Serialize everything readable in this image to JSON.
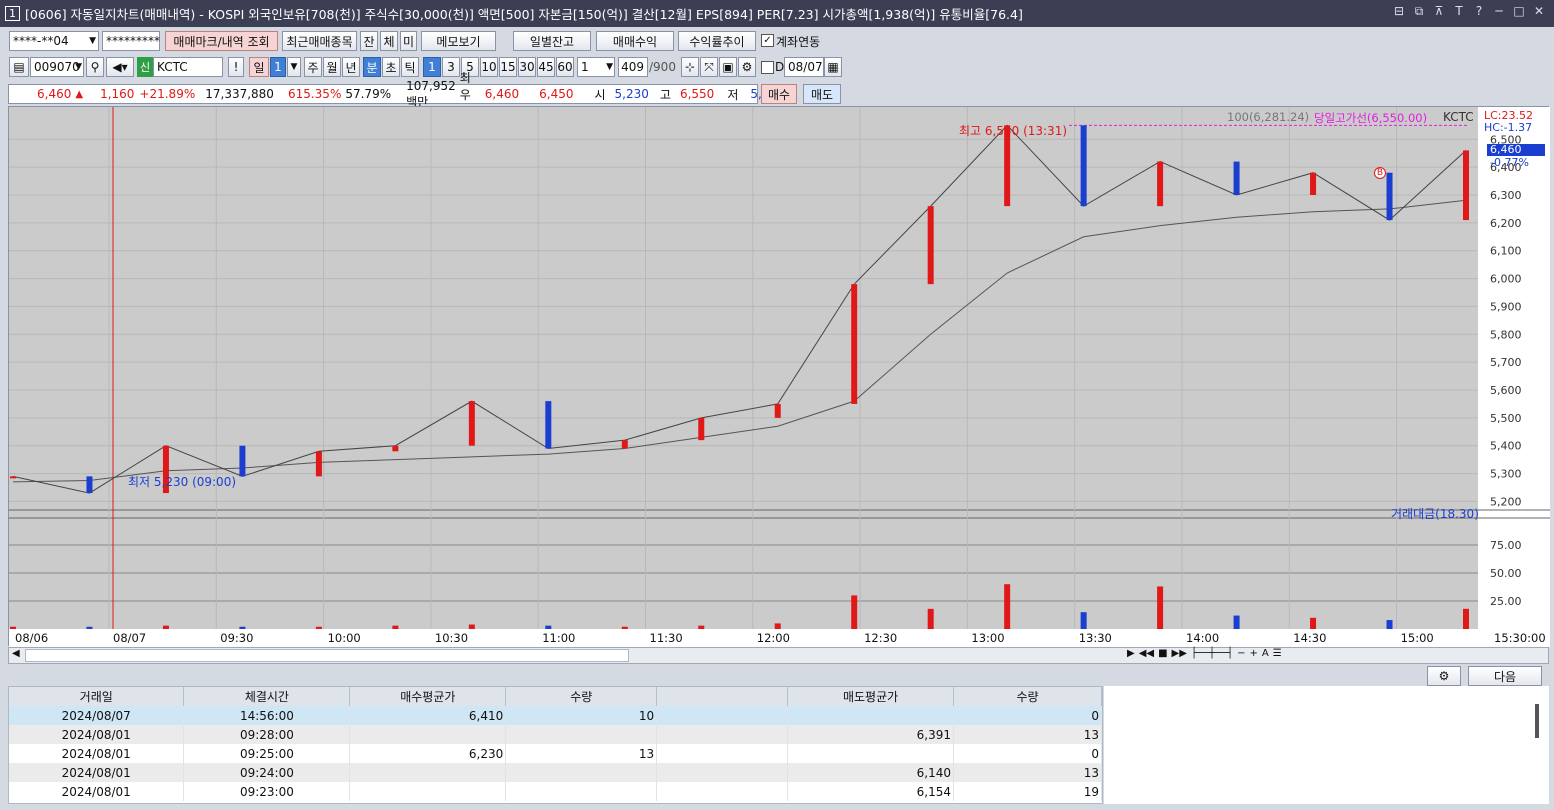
{
  "window": {
    "number": "1",
    "title": "[0606] 자동일지차트(매매내역) - KOSPI 외국인보유[708(천)] 주식수[30,000(천)] 액면[500] 자본금[150(억)] 결산[12월] EPS[894] PER[7.23] 시가총액[1,938(억)] 유통비율[76.4]"
  },
  "toolbar1": {
    "account": "****-**04",
    "password": "*********",
    "mark_btn": "매매마크/내역 조회",
    "recent_btn": "최근매매종목",
    "jan": "잔",
    "che": "체",
    "mi": "미",
    "memo_btn": "메모보기",
    "daily_btn": "일별잔고",
    "profit_btn": "매매수익",
    "rate_btn": "수익률추이",
    "link_label": "계좌연동"
  },
  "toolbar2": {
    "code": "009070",
    "credit": "신",
    "name": "KCTC",
    "periods": [
      "일",
      "1",
      "주",
      "월",
      "년",
      "분",
      "초",
      "틱"
    ],
    "intervals": [
      "1",
      "3",
      "5",
      "10",
      "15",
      "30",
      "45",
      "60"
    ],
    "count": "1",
    "bars": "409",
    "bars_max": "/900",
    "d_label": "D",
    "date": "08/07"
  },
  "quote": {
    "price": "6,460",
    "arrow": "▲",
    "change": "1,160",
    "rate": "+21.89%",
    "volume": "17,337,880",
    "vol_ratio": "615.35%",
    "turnover": "57.79%",
    "amount": "107,952백만",
    "best_label": "최우선",
    "ask": "6,460",
    "bid": "6,450",
    "open_label": "시",
    "open": "5,230",
    "high_label": "고",
    "high": "6,550",
    "low_label": "저",
    "low": "5,230",
    "buy_btn": "매수",
    "sell_btn": "매도"
  },
  "chart": {
    "ma_label": "100(6,281.24)",
    "high_line_label": "당일고가선(6,550.00)",
    "symbol": "KCTC",
    "lc": "LC:23.52",
    "hc": "HC:-1.37",
    "cur_price": "6,460",
    "cur_rate": "-0.77%",
    "high_marker": "최고 6,550 (13:31)",
    "low_marker": "최저 5,230 (09:00)",
    "vol_label": "거래대금(18.30)",
    "price_ticks": [
      "6,500",
      "6,400",
      "6,300",
      "6,200",
      "6,100",
      "6,000",
      "5,900",
      "5,800",
      "5,700",
      "5,600",
      "5,500",
      "5,400",
      "5,300",
      "5,200"
    ],
    "vol_ticks": [
      "75.00",
      "50.00",
      "25.00"
    ],
    "time_ticks": [
      "08/06",
      "08/07",
      "09:30",
      "10:00",
      "10:30",
      "11:00",
      "11:30",
      "12:00",
      "12:30",
      "13:00",
      "13:30",
      "14:00",
      "14:30",
      "15:00",
      "15:30:00"
    ],
    "buy_marker": "B"
  },
  "chart_data": {
    "type": "line",
    "title": "",
    "xlabel": "",
    "ylabel": "",
    "x": [
      "08/06",
      "09:00",
      "09:30",
      "10:00",
      "10:30",
      "11:00",
      "11:20",
      "11:30",
      "12:00",
      "12:30",
      "12:55",
      "13:00",
      "13:10",
      "13:31",
      "14:00",
      "14:15",
      "14:30",
      "14:45",
      "15:00",
      "15:20"
    ],
    "series": [
      {
        "values": [
          5290,
          5230,
          5400,
          5290,
          5380,
          5400,
          5560,
          5390,
          5420,
          5500,
          5550,
          5980,
          6260,
          6550,
          6260,
          6420,
          6300,
          6380,
          6210,
          6460
        ]
      },
      {
        "name": "100",
        "values": [
          5270,
          5275,
          5310,
          5320,
          5340,
          5350,
          5360,
          5370,
          5390,
          5430,
          5470,
          5560,
          5800,
          6020,
          6150,
          6190,
          6220,
          6240,
          6250,
          6281
        ]
      }
    ],
    "ylim": [
      5180,
      6580
    ],
    "volume": [
      2,
      2,
      3,
      2,
      2,
      3,
      4,
      3,
      2,
      3,
      5,
      30,
      18,
      40,
      15,
      38,
      12,
      10,
      8,
      18
    ],
    "volume_ylim": [
      0,
      100
    ],
    "grid": true
  },
  "grid": {
    "headers": [
      "거래일",
      "체결시간",
      "매수평균가",
      "수량",
      "",
      "매도평균가",
      "수량"
    ],
    "next_btn": "다음",
    "rows": [
      [
        "2024/08/07",
        "14:56:00",
        "6,410",
        "10",
        "",
        "",
        "0"
      ],
      [
        "2024/08/01",
        "09:28:00",
        "",
        "",
        "",
        "6,391",
        "13"
      ],
      [
        "2024/08/01",
        "09:25:00",
        "6,230",
        "13",
        "",
        "",
        "0"
      ],
      [
        "2024/08/01",
        "09:24:00",
        "",
        "",
        "",
        "6,140",
        "13"
      ],
      [
        "2024/08/01",
        "09:23:00",
        "",
        "",
        "",
        "6,154",
        "19"
      ]
    ]
  }
}
